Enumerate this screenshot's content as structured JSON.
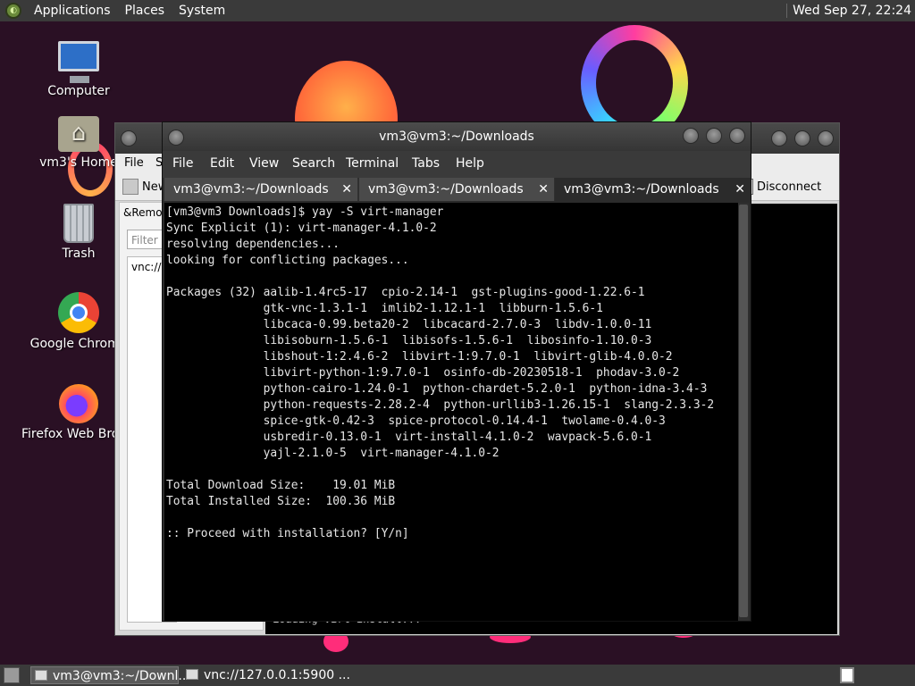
{
  "top_panel": {
    "menus": [
      "Applications",
      "Places",
      "System"
    ],
    "clock": "Wed Sep 27, 22:24"
  },
  "desktop_icons": [
    {
      "label": "Computer",
      "icon": "computer-icon"
    },
    {
      "label": "vm3's Home",
      "icon": "home-folder-icon"
    },
    {
      "label": "Trash",
      "icon": "trash-icon"
    },
    {
      "label": "Google Chrome",
      "icon": "chrome-icon"
    },
    {
      "label": "Firefox Web Browser",
      "icon": "firefox-icon"
    }
  ],
  "bg_window": {
    "menus": [
      "File",
      "S"
    ],
    "toolbar_new": "New",
    "toolbar_disconnect": "Disconnect",
    "remote_label": "&Remote",
    "filter_placeholder": "Filter",
    "vnc_item": "vnc://127.0.0.1:5900",
    "remote_text": "Loading virt-install..."
  },
  "terminal": {
    "title": "vm3@vm3:~/Downloads",
    "menus": [
      "File",
      "Edit",
      "View",
      "Search",
      "Terminal",
      "Tabs",
      "Help"
    ],
    "tabs": [
      {
        "label": "vm3@vm3:~/Downloads",
        "active": false
      },
      {
        "label": "vm3@vm3:~/Downloads",
        "active": false
      },
      {
        "label": "vm3@vm3:~/Downloads",
        "active": true
      }
    ],
    "lines": [
      "[vm3@vm3 Downloads]$ yay -S virt-manager",
      "Sync Explicit (1): virt-manager-4.1.0-2",
      "resolving dependencies...",
      "looking for conflicting packages...",
      "",
      "Packages (32) aalib-1.4rc5-17  cpio-2.14-1  gst-plugins-good-1.22.6-1",
      "              gtk-vnc-1.3.1-1  imlib2-1.12.1-1  libburn-1.5.6-1",
      "              libcaca-0.99.beta20-2  libcacard-2.7.0-3  libdv-1.0.0-11",
      "              libisoburn-1.5.6-1  libisofs-1.5.6-1  libosinfo-1.10.0-3",
      "              libshout-1:2.4.6-2  libvirt-1:9.7.0-1  libvirt-glib-4.0.0-2",
      "              libvirt-python-1:9.7.0-1  osinfo-db-20230518-1  phodav-3.0-2",
      "              python-cairo-1.24.0-1  python-chardet-5.2.0-1  python-idna-3.4-3",
      "              python-requests-2.28.2-4  python-urllib3-1.26.15-1  slang-2.3.3-2",
      "              spice-gtk-0.42-3  spice-protocol-0.14.4-1  twolame-0.4.0-3",
      "              usbredir-0.13.0-1  virt-install-4.1.0-2  wavpack-5.6.0-1",
      "              yajl-2.1.0-5  virt-manager-4.1.0-2",
      "",
      "Total Download Size:    19.01 MiB",
      "Total Installed Size:  100.36 MiB",
      "",
      ":: Proceed with installation? [Y/n]"
    ]
  },
  "taskbar": {
    "items": [
      {
        "label": "vm3@vm3:~/Downl...",
        "active": true
      },
      {
        "label": "vnc://127.0.0.1:5900 ...",
        "active": false
      }
    ]
  }
}
